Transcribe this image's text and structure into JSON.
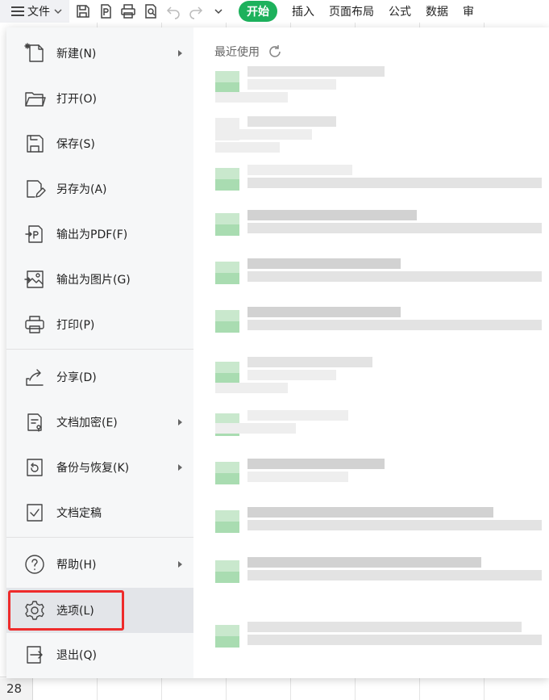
{
  "toolbar": {
    "file_label": "文件",
    "tabs": [
      "开始",
      "插入",
      "页面布局",
      "公式",
      "数据",
      "审"
    ]
  },
  "menu": {
    "items": [
      {
        "label": "新建(N)",
        "icon": "new-file-icon",
        "submenu": true
      },
      {
        "label": "打开(O)",
        "icon": "folder-open-icon",
        "submenu": false
      },
      {
        "label": "保存(S)",
        "icon": "save-icon",
        "submenu": false
      },
      {
        "label": "另存为(A)",
        "icon": "save-as-icon",
        "submenu": false
      },
      {
        "label": "输出为PDF(F)",
        "icon": "export-pdf-icon",
        "submenu": false
      },
      {
        "label": "输出为图片(G)",
        "icon": "export-image-icon",
        "submenu": false
      },
      {
        "label": "打印(P)",
        "icon": "print-icon",
        "submenu": false
      },
      {
        "label": "分享(D)",
        "icon": "share-icon",
        "submenu": false
      },
      {
        "label": "文档加密(E)",
        "icon": "encrypt-document-icon",
        "submenu": true
      },
      {
        "label": "备份与恢复(K)",
        "icon": "backup-restore-icon",
        "submenu": true
      },
      {
        "label": "文档定稿",
        "icon": "finalize-document-icon",
        "submenu": false
      },
      {
        "label": "帮助(H)",
        "icon": "help-icon",
        "submenu": true
      },
      {
        "label": "选项(L)",
        "icon": "gear-icon",
        "submenu": false,
        "selected": true
      },
      {
        "label": "退出(Q)",
        "icon": "exit-icon",
        "submenu": false
      }
    ]
  },
  "recent": {
    "title": "最近使用"
  },
  "sheet": {
    "visible_row_number": "28"
  },
  "colors": {
    "accent_green": "#1db15c",
    "highlight_red": "#ee2b2b"
  }
}
